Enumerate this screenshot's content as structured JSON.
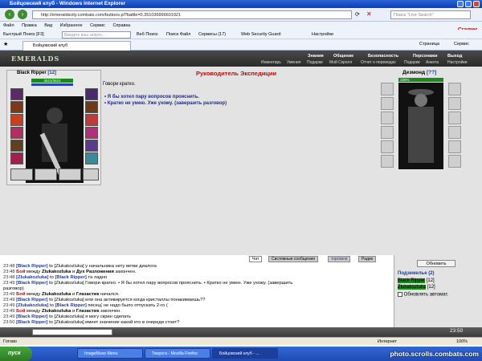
{
  "window": {
    "title": "Бойцовский клуб - Windows Internet Explorer"
  },
  "address": {
    "url": "http://emeraldscity.combats.com/buttons.pl?battle=0.351036996601921",
    "live_search_placeholder": "Поиск \"Live Search\""
  },
  "menu": {
    "items": [
      "Файл",
      "Правка",
      "Вид",
      "Избранное",
      "Сервис",
      "Справка"
    ],
    "brand": "Cramer"
  },
  "toolbar": {
    "quick_search": "Быстрый Поиск [F3]",
    "search_placeholder": "Введите ваш запрос...",
    "web_search": "Веб Поиск",
    "search_files": "Поиск Файл",
    "services": "Сервисы (17)",
    "security": "Web Security Guard",
    "settings": "Настройки"
  },
  "tab": {
    "label": "Бойцовский клуб",
    "page_btn": "Страница",
    "service_btn": "Сервис"
  },
  "game": {
    "logo": "EMERALDS",
    "nav_top": [
      "Знания",
      "Общение",
      "Безопасность",
      "Персонажи",
      "Выход"
    ],
    "nav_sub": [
      "Инвентарь",
      "Умения",
      "Подарки",
      "Мой Скролл",
      "Отчет о переводах",
      "Подарки",
      "Анкета",
      "Настройки"
    ],
    "left_name": "Black Ripper",
    "left_level": "[12]",
    "left_hp": "3621/3621",
    "dialog_title": "Руководитель Экспедиции",
    "dialog_text": "Говори кратко.",
    "options": [
      "Я бы хотел пару вопросов прояснить.",
      "Кратко не умею. Уже ухожу. (завершить разговор)"
    ],
    "right_name": "Дезмонд",
    "right_level": "[??]",
    "right_hp": "100%"
  },
  "chat": {
    "tabs": [
      "Чат",
      "Системные сообщения",
      "торговля",
      "Радио"
    ],
    "lines": [
      {
        "time": "23:48",
        "html": "<span class='n'>[Black Ripper]</span> to [Zlukakozluka] у начальника нету ветки диалога"
      },
      {
        "time": "23:48",
        "html": "<span class='r b'>Бой</span> между <span class='b'>Zlukakozluka</span> и <span class='b'>Дух Разложения</span> закончен."
      },
      {
        "time": "23:48",
        "html": "<span class='n'>[Zlukakozluka]</span> to <span class='n'>[Black Ripper]</span> та ладно"
      },
      {
        "time": "23:49",
        "html": "<span class='n'>[Black Ripper]</span> to [Zlukakozluka] Говори кратко. • Я бы хотел пару вопросов прояснить. • Кратко не умею. Уже ухожу. (завершить"
      },
      {
        "time": "",
        "html": "разговор)"
      },
      {
        "time": "23:49",
        "html": "<span class='r b'>Бой</span> между <span class='b'>Zlukakozluka</span> и <span class='b'>Глазастик</span> начался."
      },
      {
        "time": "23:49",
        "html": "<span class='n'>[Black Ripper]</span> to [Zlukakozluka] или она активируется когда кристаллы понакимаешь??"
      },
      {
        "time": "23:49",
        "html": "<span class='n'>[Zlukakozluka]</span> to <span class='n'>[Black Ripper]</span> писец( не надо было отпускать 2-го ("
      },
      {
        "time": "23:49",
        "html": "<span class='r b'>Бой</span> между <span class='b'>Zlukakozluka</span> и <span class='b'>Глазастик</span> закончен."
      },
      {
        "time": "23:49",
        "html": "<span class='n'>[Black Ripper]</span> to [Zlukakozluka] я могу скрин сделать"
      },
      {
        "time": "23:50",
        "html": "<span class='n'>[Black Ripper]</span> to [Zlukakozluka] имеет значение какой кто в очереди стоит?"
      }
    ]
  },
  "online": {
    "refresh": "Обновить",
    "location": "Подземелье (2)",
    "users": [
      {
        "name": "Black Ripper",
        "level": "[12]"
      },
      {
        "name": "Zlukakozluka",
        "level": "[12]"
      }
    ],
    "auto_label": "Обновлять автомат."
  },
  "status": {
    "left": "Готово",
    "zone": "Интернет",
    "zoom": "100%",
    "clock": "23:50"
  },
  "taskbar": {
    "start": "пуск",
    "items": [
      "ImageMuse Menu",
      "Творога - Mozilla Firefox",
      "Бойцовский клуб - ..."
    ],
    "watermark": "photo.scrolls.combats.com"
  }
}
